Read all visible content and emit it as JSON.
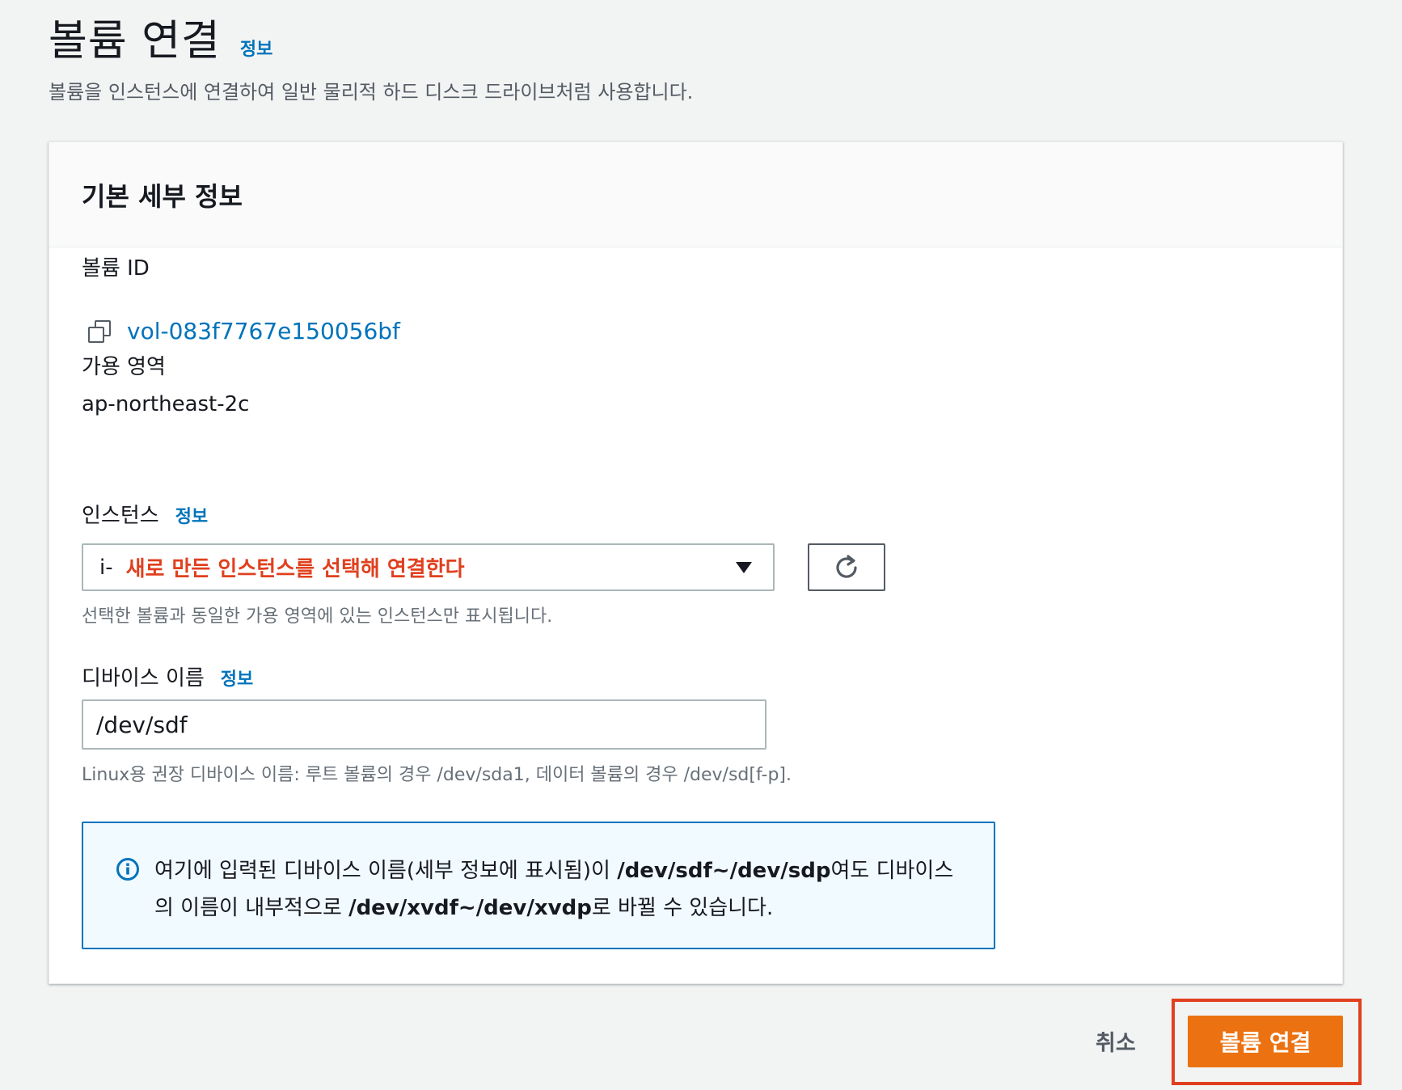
{
  "header": {
    "title": "볼륨 연결",
    "info_label": "정보",
    "description": "볼륨을 인스턴스에 연결하여 일반 물리적 하드 디스크 드라이브처럼 사용합니다."
  },
  "panel": {
    "title": "기본 세부 정보",
    "volume_id": {
      "label": "볼륨 ID",
      "value": "vol-083f7767e150056bf",
      "icon": "copy-icon"
    },
    "availability_zone": {
      "label": "가용 영역",
      "value": "ap-northeast-2c"
    },
    "instance": {
      "label": "인스턴스",
      "info_label": "정보",
      "selected_prefix": "i-",
      "selected_value": "새로 만든 인스턴스를 선택해 연결한다",
      "constraint": "선택한 볼륨과 동일한 가용 영역에 있는 인스턴스만 표시됩니다.",
      "refresh_icon": "refresh-icon"
    },
    "device_name": {
      "label": "디바이스 이름",
      "info_label": "정보",
      "value": "/dev/sdf",
      "constraint": "Linux용 권장 디바이스 이름: 루트 볼륨의 경우 /dev/sda1, 데이터 볼륨의 경우 /dev/sd[f-p]."
    },
    "alert": {
      "icon": "info-icon",
      "text_1": "여기에 입력된 디바이스 이름(세부 정보에 표시됨)이 ",
      "bold_1": "/dev/sdf~/dev/sdp",
      "text_2": "여도 디바이스의 이름이 내부적으로 ",
      "bold_2": "/dev/xvdf~/dev/xvdp",
      "text_3": "로 바뀔 수 있습니다."
    }
  },
  "footer": {
    "cancel_label": "취소",
    "submit_label": "볼륨 연결"
  },
  "colors": {
    "link": "#0073bb",
    "primary": "#ec7211",
    "annotation": "#e0401f"
  }
}
